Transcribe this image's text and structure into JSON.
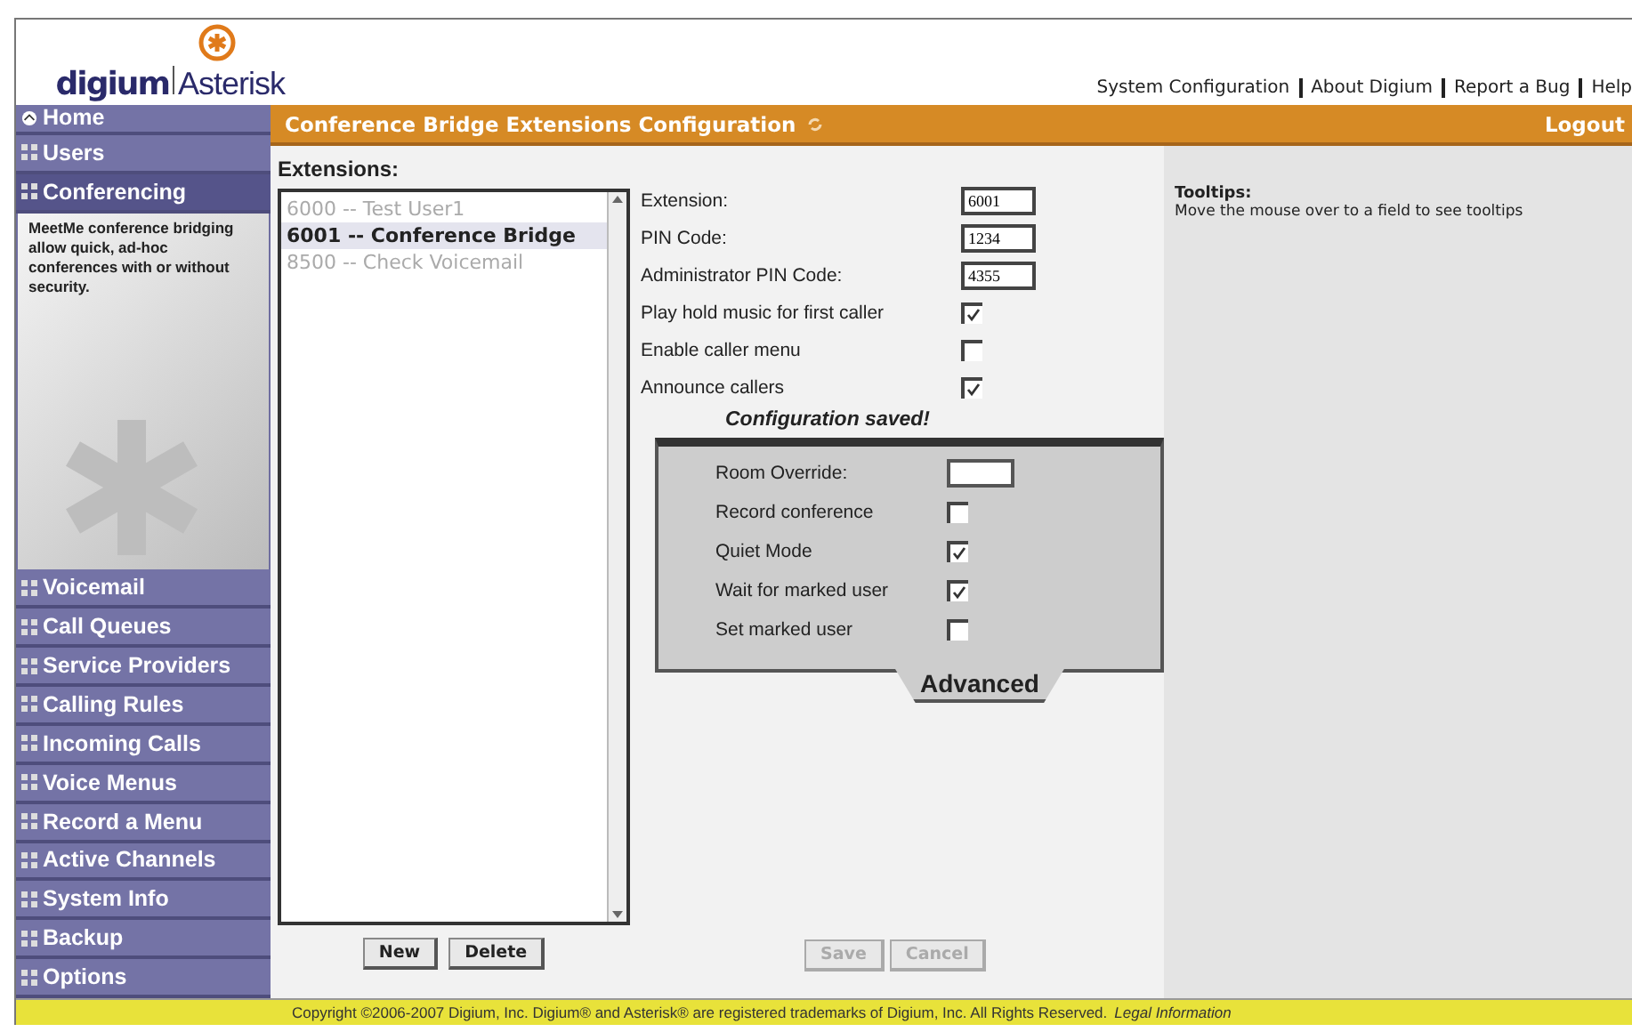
{
  "logo": {
    "left": "digium",
    "right": "Asterisk"
  },
  "top_links": [
    "System Configuration",
    "About Digium",
    "Report a Bug",
    "Help"
  ],
  "sidebar": {
    "home": "Home",
    "items": [
      {
        "label": "Users",
        "selected": false
      },
      {
        "label": "Conferencing",
        "selected": true,
        "description": "MeetMe conference bridging allow quick, ad-hoc conferences with or without security."
      },
      {
        "label": "Voicemail",
        "selected": false
      },
      {
        "label": "Call Queues",
        "selected": false
      },
      {
        "label": "Service Providers",
        "selected": false
      },
      {
        "label": "Calling Rules",
        "selected": false
      },
      {
        "label": "Incoming Calls",
        "selected": false
      },
      {
        "label": "Voice Menus",
        "selected": false
      },
      {
        "label": "Record a Menu",
        "selected": false
      },
      {
        "label": "Active Channels",
        "selected": false
      },
      {
        "label": "System Info",
        "selected": false
      },
      {
        "label": "Backup",
        "selected": false
      },
      {
        "label": "Options",
        "selected": false
      }
    ]
  },
  "title_bar": {
    "title": "Conference Bridge Extensions Configuration",
    "logout": "Logout"
  },
  "extensions": {
    "label": "Extensions:",
    "items": [
      {
        "label": "6000 -- Test User1",
        "selected": false
      },
      {
        "label": "6001 -- Conference Bridge",
        "selected": true
      },
      {
        "label": "8500 -- Check Voicemail",
        "selected": false
      }
    ],
    "buttons": [
      "New",
      "Delete"
    ]
  },
  "form": {
    "fields": [
      {
        "kind": "text",
        "label": "Extension:",
        "value": "6001"
      },
      {
        "kind": "text",
        "label": "PIN Code:",
        "value": "1234"
      },
      {
        "kind": "text",
        "label": "Administrator PIN Code:",
        "value": "4355"
      },
      {
        "kind": "checkbox",
        "label": "Play hold music for first caller",
        "checked": true
      },
      {
        "kind": "checkbox",
        "label": "Enable caller menu",
        "checked": false
      },
      {
        "kind": "checkbox",
        "label": "Announce callers",
        "checked": true
      }
    ],
    "status": "Configuration saved!",
    "advanced": {
      "title": "Advanced",
      "fields": [
        {
          "kind": "text",
          "label": "Room Override:"
        },
        {
          "kind": "checkbox",
          "label": "Record conference",
          "checked": false
        },
        {
          "kind": "checkbox",
          "label": "Quiet Mode",
          "checked": true
        },
        {
          "kind": "checkbox",
          "label": "Wait for marked user",
          "checked": true
        },
        {
          "kind": "checkbox",
          "label": "Set marked user",
          "checked": false
        }
      ]
    },
    "buttons": [
      {
        "label": "Save",
        "disabled": true
      },
      {
        "label": "Cancel",
        "disabled": true
      }
    ]
  },
  "tooltips": {
    "title": "Tooltips:",
    "text": "Move the mouse over to a field to see tooltips"
  },
  "footer": {
    "text": "Copyright ©2006-2007 Digium, Inc. Digium® and Asterisk® are registered trademarks of Digium, Inc. All Rights Reserved.",
    "link": "Legal Information"
  }
}
